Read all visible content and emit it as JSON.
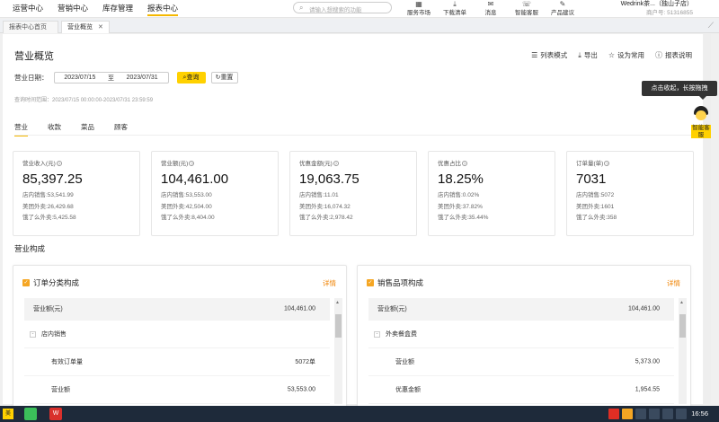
{
  "topnav": {
    "menu": [
      "运营中心",
      "营销中心",
      "库存管理",
      "报表中心"
    ],
    "active_menu": "报表中心",
    "search_placeholder": "请输入想搜索的功能",
    "tools": [
      {
        "icon": "store-icon",
        "label": "服务市场"
      },
      {
        "icon": "download-icon",
        "label": "下载清单"
      },
      {
        "icon": "message-icon",
        "label": "消息"
      },
      {
        "icon": "support-icon",
        "label": "智能客服"
      },
      {
        "icon": "feedback-icon",
        "label": "产品建议"
      }
    ],
    "user_name": "Wedrink茶...（独山子店）",
    "merchant_id": "商户号: 51316855"
  },
  "tabs": [
    {
      "label": "报表中心首页",
      "closable": false
    },
    {
      "label": "营业概览",
      "closable": true,
      "active": true
    }
  ],
  "page": {
    "title": "营业概览",
    "actions": [
      {
        "icon": "list-icon",
        "label": "列表模式"
      },
      {
        "icon": "export-icon",
        "label": "导出"
      },
      {
        "icon": "star-icon",
        "label": "设为常用"
      },
      {
        "icon": "help-icon",
        "label": "报表说明"
      }
    ],
    "date_label": "营业日期：",
    "date_start": "2023/07/15",
    "date_sep": "至",
    "date_end": "2023/07/31",
    "query_btn": "查询",
    "reset_btn": "重置",
    "query_range": "查询时间范围：2023/07/15 00:00:00-2023/07/31 23:59:59",
    "subtabs": [
      "营业",
      "收款",
      "菜品",
      "顾客"
    ],
    "active_subtab": "营业",
    "section_title": "营业构成"
  },
  "cards": [
    {
      "label": "营业收入(元)",
      "value": "85,397.25",
      "lines": [
        "店内销售:53,541.99",
        "美团外卖:26,429.68",
        "饿了么外卖:5,425.58"
      ]
    },
    {
      "label": "营业额(元)",
      "value": "104,461.00",
      "lines": [
        "店内销售:53,553.00",
        "美团外卖:42,504.00",
        "饿了么外卖:8,404.00"
      ]
    },
    {
      "label": "优惠金额(元)",
      "value": "19,063.75",
      "lines": [
        "店内销售:11.01",
        "美团外卖:16,074.32",
        "饿了么外卖:2,978.42"
      ]
    },
    {
      "label": "优惠占比",
      "value": "18.25%",
      "lines": [
        "店内销售:0.02%",
        "美团外卖:37.82%",
        "饿了么外卖:35.44%"
      ]
    },
    {
      "label": "订单量(单)",
      "value": "7031",
      "lines": [
        "店内销售:5072",
        "美团外卖:1601",
        "饿了么外卖:358"
      ]
    }
  ],
  "panels": [
    {
      "title": "订单分类构成",
      "detail": "详情",
      "head": {
        "k": "营业额(元)",
        "v": "104,461.00"
      },
      "group": "店内销售",
      "rows": [
        {
          "k": "有效订单量",
          "v": "5072单"
        },
        {
          "k": "营业额",
          "v": "53,553.00"
        }
      ]
    },
    {
      "title": "销售品项构成",
      "detail": "详情",
      "head": {
        "k": "营业额(元)",
        "v": "104,461.00"
      },
      "group": "外卖餐盒费",
      "rows": [
        {
          "k": "营业额",
          "v": "5,373.00"
        },
        {
          "k": "优惠金额",
          "v": "1,954.55"
        }
      ]
    }
  ],
  "helper": {
    "tip": "点击收起，长按拖拽",
    "label": "智能客服"
  },
  "taskbar": {
    "start": "美",
    "time": "16:56"
  },
  "colors": {
    "accent": "#ffd100",
    "link": "#f08200"
  }
}
